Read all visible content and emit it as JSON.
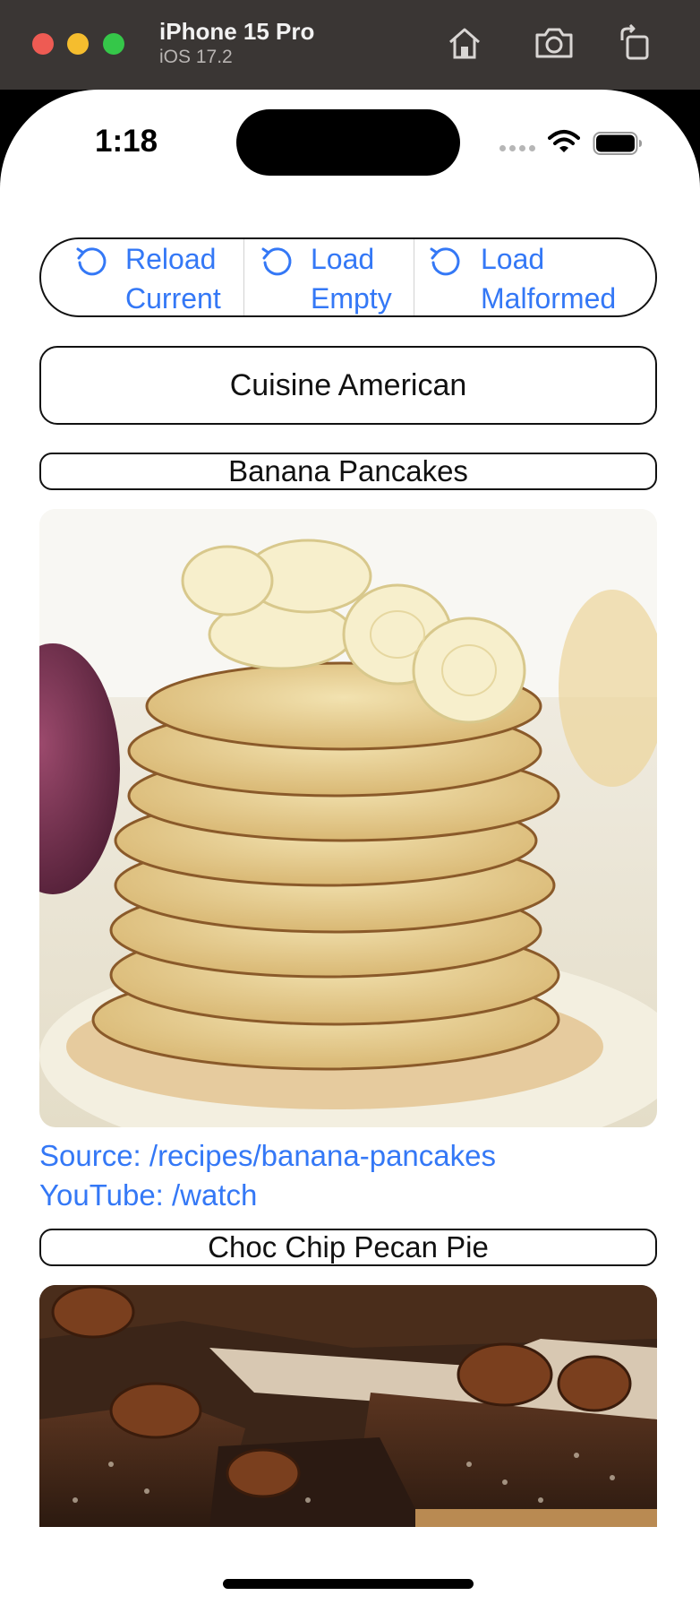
{
  "simulator": {
    "device_name": "iPhone 15 Pro",
    "os_version": "iOS 17.2",
    "icons": [
      "home-icon",
      "screenshot-icon",
      "rotate-icon"
    ]
  },
  "status_bar": {
    "time": "1:18",
    "icons": [
      "cellular-signal-icon",
      "wifi-icon",
      "battery-icon"
    ]
  },
  "reload_controls": [
    {
      "label": "Reload\nCurrent",
      "icon": "reload-icon"
    },
    {
      "label": "Load\nEmpty",
      "icon": "reload-icon"
    },
    {
      "label": "Load\nMalformed",
      "icon": "reload-icon"
    }
  ],
  "cuisine": {
    "label": "Cuisine American"
  },
  "recipes": [
    {
      "name": "Banana Pancakes",
      "source": "Source: /recipes/banana-pancakes",
      "youtube": "YouTube: /watch"
    },
    {
      "name": "Choc Chip Pecan Pie"
    }
  ],
  "colors": {
    "accent": "#3478f6",
    "chrome": "#3a3634",
    "traffic_red": "#ee5b53",
    "traffic_yellow": "#f5bd2e",
    "traffic_green": "#35c749"
  }
}
